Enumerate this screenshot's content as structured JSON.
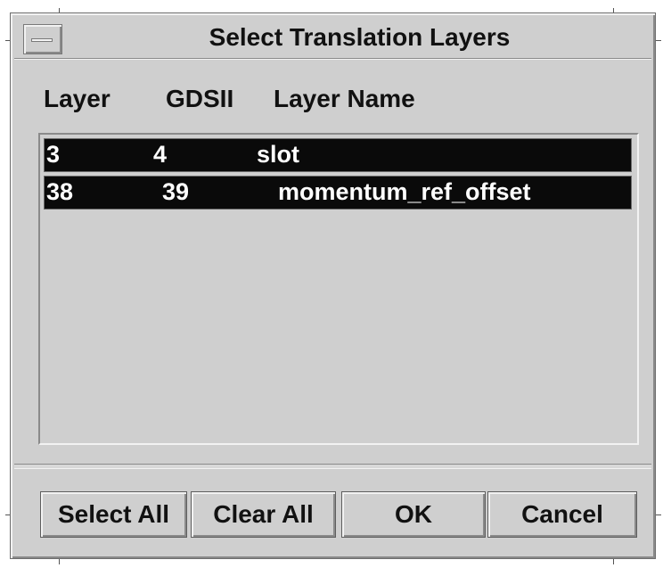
{
  "dialog": {
    "title": "Select Translation Layers"
  },
  "columns": {
    "layer": "Layer",
    "gdsii": "GDSII",
    "layer_name": "Layer Name"
  },
  "rows": [
    {
      "layer": "3",
      "gdsii": "4",
      "name": "slot",
      "selected": true
    },
    {
      "layer": "38",
      "gdsii": "39",
      "name": "momentum_ref_offset",
      "selected": true
    }
  ],
  "buttons": {
    "select_all": "Select All",
    "clear_all": "Clear All",
    "ok": "OK",
    "cancel": "Cancel"
  },
  "colors": {
    "dialog_bg": "#cfcfcf",
    "selected_row_bg": "#0a0a0a",
    "selected_row_text": "#ffffff"
  },
  "icons": {
    "window_menu": "window-menu-icon"
  }
}
